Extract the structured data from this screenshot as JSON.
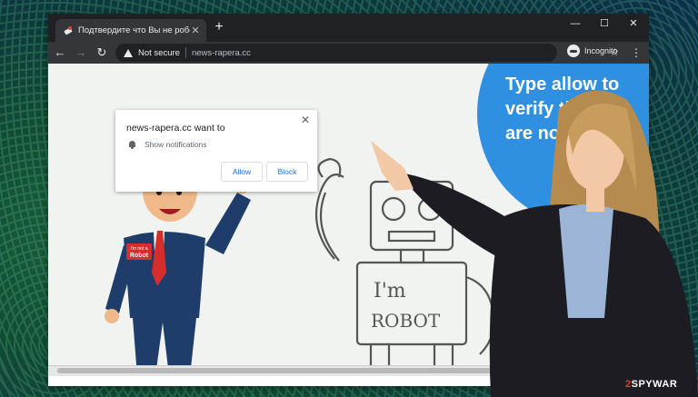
{
  "tab": {
    "title": "Подтвердите что Вы не робот",
    "close_label": "✕",
    "new_tab_label": "+"
  },
  "window_controls": {
    "minimize": "—",
    "maximize": "☐",
    "close": "✕"
  },
  "nav": {
    "back": "←",
    "forward": "→",
    "reload": "↻"
  },
  "address": {
    "security_label": "Not secure",
    "url": "news-rapera.cc"
  },
  "profile": {
    "label": "Incognito"
  },
  "menu": {
    "kebab": "⋮"
  },
  "page": {
    "headline_lines": [
      "Type allow to",
      "verify th",
      "are not"
    ],
    "badge_lines": [
      "I'm not a",
      "Robot"
    ],
    "robot_text_1": "I'm",
    "robot_text_2": "ROBOT"
  },
  "permission_prompt": {
    "title": "news-rapera.cc want to",
    "request": "Show notifications",
    "allow_label": "Allow",
    "block_label": "Block",
    "close_label": "✕"
  },
  "watermark": {
    "prefix": "2",
    "rest": "SPYWAR"
  },
  "colors": {
    "accent_blue": "#2f8fe0",
    "chrome_dark": "#202124",
    "suit_navy": "#1f3d6b",
    "tie_red": "#d62d2d"
  }
}
